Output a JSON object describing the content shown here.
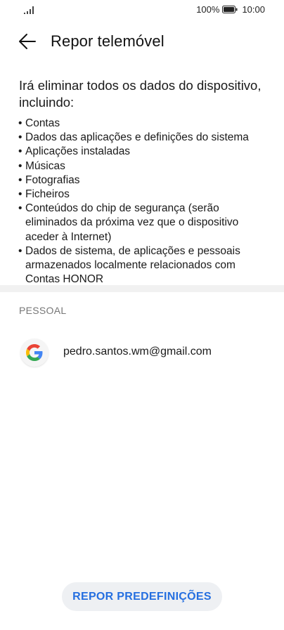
{
  "status_bar": {
    "battery_percent": "100%",
    "time": "10:00",
    "icons": [
      "signal-icon",
      "battery-icon"
    ]
  },
  "header": {
    "title": "Repor telemóvel",
    "back_icon": "arrow-left-icon"
  },
  "content": {
    "intro": "Irá eliminar todos os dados do dispositivo, incluindo:",
    "items": [
      "Contas",
      "Dados das aplicações e definições do sistema",
      "Aplicações instaladas",
      "Músicas",
      "Fotografias",
      "Ficheiros",
      "Conteúdos do chip de segurança (serão eliminados da próxima vez que o dispositivo aceder à Internet)",
      "Dados de sistema, de aplicações e pessoais armazenados localmente relacionados com Contas HONOR"
    ]
  },
  "accounts": {
    "section_title": "PESSOAL",
    "items": [
      {
        "icon": "google-icon",
        "email": "pedro.santos.wm@gmail.com"
      }
    ]
  },
  "actions": {
    "reset_label": "REPOR PREDEFINIÇÕES"
  },
  "colors": {
    "accent": "#256fe0",
    "button_bg": "#eef0f3",
    "divider": "#f1f1f1",
    "section_header": "#777777"
  }
}
